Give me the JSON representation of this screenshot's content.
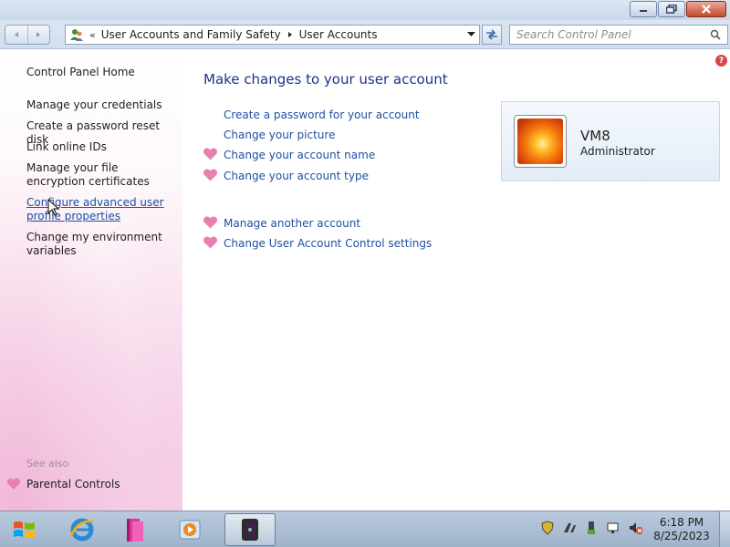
{
  "window": {
    "minimize_icon": "minimize-icon",
    "maximize_icon": "restore-icon",
    "close_icon": "close-icon"
  },
  "navigation": {
    "back_icon": "back-arrow-icon",
    "forward_icon": "forward-arrow-icon",
    "overflow_marker": "«",
    "breadcrumb": [
      "User Accounts and Family Safety",
      "User Accounts"
    ],
    "refresh_icon": "refresh-icon",
    "search_placeholder": "Search Control Panel"
  },
  "sidebar": {
    "home": "Control Panel Home",
    "links": [
      "Manage your credentials",
      "Create a password reset disk",
      "Link online IDs",
      "Manage your file encryption certificates",
      "Configure advanced user profile properties",
      "Change my environment variables"
    ],
    "see_also_label": "See also",
    "see_also_links": [
      "Parental Controls"
    ]
  },
  "main": {
    "title": "Make changes to your user account",
    "tasks": [
      {
        "label": "Create a password for your account",
        "shield": false
      },
      {
        "label": "Change your picture",
        "shield": false
      },
      {
        "label": "Change your account name",
        "shield": true
      },
      {
        "label": "Change your account type",
        "shield": true
      }
    ],
    "other_tasks": [
      {
        "label": "Manage another account",
        "shield": true
      },
      {
        "label": "Change User Account Control settings",
        "shield": true
      }
    ]
  },
  "account": {
    "name": "VM8",
    "role": "Administrator",
    "picture": "orange-flower-picture"
  },
  "taskbar": {
    "apps": [
      "windows-start-icon",
      "internet-explorer-icon",
      "file-manager-icon",
      "media-player-icon",
      "terminal-app-icon"
    ],
    "tray_icons": [
      "security-shield-icon",
      "network-tool-icon",
      "usb-device-icon",
      "action-center-flag-icon",
      "volume-muted-icon"
    ],
    "time": "6:18 PM",
    "date": "8/25/2023"
  },
  "colors": {
    "link": "#1e50a2",
    "title": "#1e3287",
    "shield_heart": "#e77fb0"
  }
}
